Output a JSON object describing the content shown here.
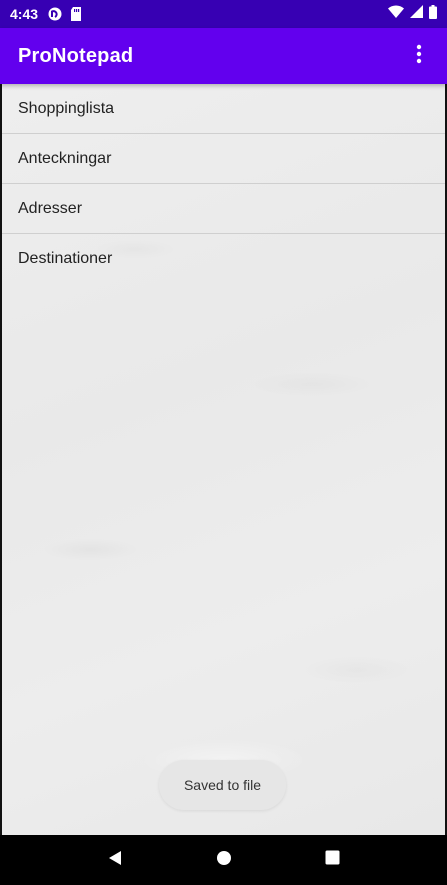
{
  "status_bar": {
    "time": "4:43",
    "icons_left": [
      "pocket-casts-icon",
      "sd-card-icon"
    ],
    "icons_right": [
      "wifi-icon",
      "cell-signal-icon",
      "battery-icon"
    ]
  },
  "app_bar": {
    "title": "ProNotepad",
    "overflow_icon": "more-vert-icon",
    "color": "#6200ee",
    "status_color": "#3700b3"
  },
  "notes": [
    {
      "label": "Shoppinglista"
    },
    {
      "label": "Anteckningar"
    },
    {
      "label": "Adresser"
    },
    {
      "label": "Destinationer"
    }
  ],
  "toast": {
    "message": "Saved to file"
  },
  "nav_bar": {
    "back": "back-icon",
    "home": "home-icon",
    "recents": "recents-icon"
  }
}
